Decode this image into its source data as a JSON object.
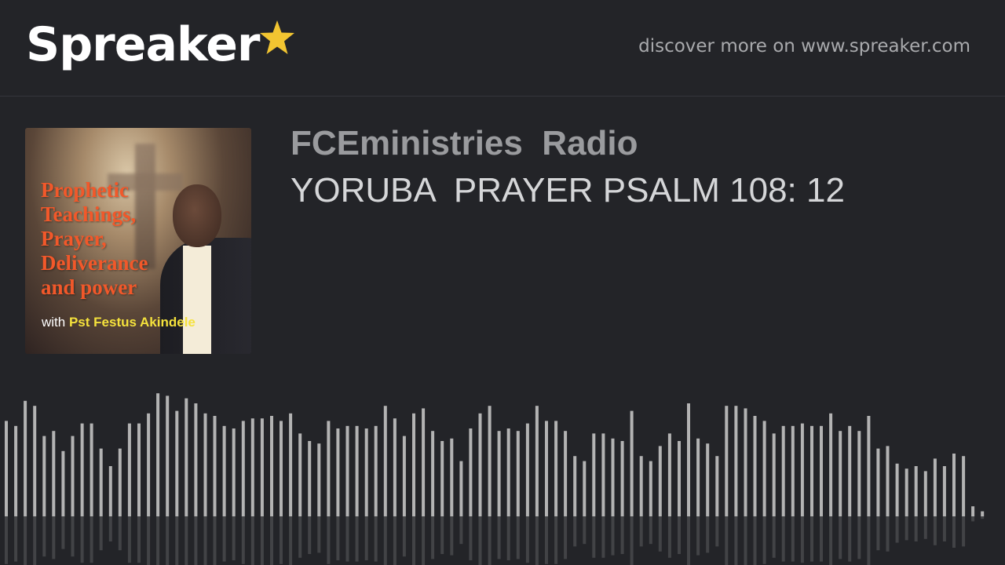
{
  "header": {
    "logo_text": "Spreaker",
    "logo_icon": "star-icon",
    "discover_text": "discover more on www.spreaker.com"
  },
  "cover": {
    "title": "Prophetic\nTeachings,\nPrayer,\nDeliverance\nand power",
    "with_text": "with",
    "host": "Pst Festus Akindele"
  },
  "show": {
    "title": "FCEministries  Radio",
    "episode_title": "YORUBA  PRAYER PSALM 108: 12"
  },
  "colors": {
    "background": "#232428",
    "star": "#f2c531",
    "waveform_bar": "#b3b3b3"
  },
  "waveform": {
    "levels": [
      0.38,
      0.36,
      0.46,
      0.44,
      0.32,
      0.34,
      0.26,
      0.32,
      0.37,
      0.37,
      0.27,
      0.2,
      0.27,
      0.37,
      0.37,
      0.41,
      0.49,
      0.48,
      0.42,
      0.47,
      0.45,
      0.41,
      0.4,
      0.36,
      0.35,
      0.38,
      0.39,
      0.39,
      0.4,
      0.38,
      0.41,
      0.33,
      0.3,
      0.29,
      0.38,
      0.35,
      0.36,
      0.36,
      0.35,
      0.36,
      0.44,
      0.39,
      0.32,
      0.41,
      0.43,
      0.34,
      0.3,
      0.31,
      0.22,
      0.35,
      0.41,
      0.44,
      0.34,
      0.35,
      0.34,
      0.37,
      0.44,
      0.38,
      0.38,
      0.34,
      0.24,
      0.22,
      0.33,
      0.33,
      0.31,
      0.3,
      0.42,
      0.24,
      0.22,
      0.28,
      0.33,
      0.3,
      0.45,
      0.31,
      0.29,
      0.24,
      0.44,
      0.44,
      0.43,
      0.4,
      0.38,
      0.33,
      0.36,
      0.36,
      0.37,
      0.36,
      0.36,
      0.41,
      0.34,
      0.36,
      0.34,
      0.4,
      0.27,
      0.28,
      0.21,
      0.19,
      0.2,
      0.18,
      0.23,
      0.2,
      0.25,
      0.24,
      0.04,
      0.02
    ]
  }
}
